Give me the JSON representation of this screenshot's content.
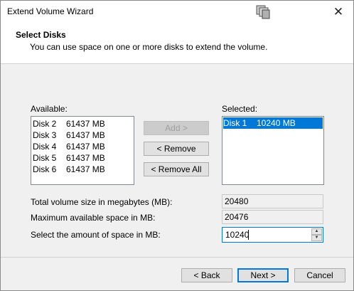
{
  "window": {
    "title": "Extend Volume Wizard",
    "close_glyph": "✕",
    "app_icon": "wizard-disk-icon"
  },
  "header": {
    "title": "Select Disks",
    "subtitle": "You can use space on one or more disks to extend the volume."
  },
  "available": {
    "label": "Available:",
    "items": [
      {
        "disk": "Disk 2",
        "size": "61437 MB"
      },
      {
        "disk": "Disk 3",
        "size": "61437 MB"
      },
      {
        "disk": "Disk 4",
        "size": "61437 MB"
      },
      {
        "disk": "Disk 5",
        "size": "61437 MB"
      },
      {
        "disk": "Disk 6",
        "size": "61437 MB"
      }
    ]
  },
  "selected": {
    "label": "Selected:",
    "items": [
      {
        "disk": "Disk 1",
        "size": "10240 MB"
      }
    ]
  },
  "buttons": {
    "add": "Add >",
    "remove": "< Remove",
    "remove_all": "< Remove All",
    "back": "< Back",
    "next": "Next >",
    "cancel": "Cancel"
  },
  "fields": {
    "total_label": "Total volume size in megabytes (MB):",
    "total_value": "20480",
    "max_label": "Maximum available space in MB:",
    "max_value": "20476",
    "amount_label": "Select the amount of space in MB:",
    "amount_value": "10240"
  }
}
